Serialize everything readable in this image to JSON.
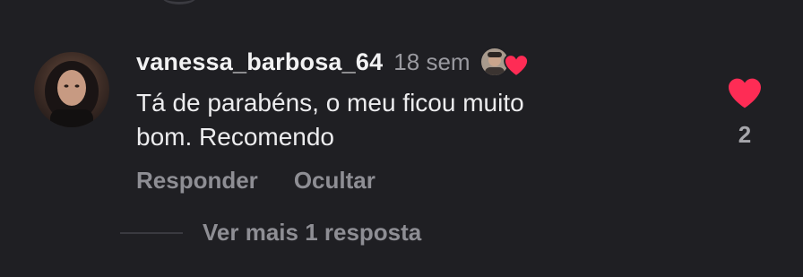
{
  "comment": {
    "username": "vanessa_barbosa_64",
    "time": "18 sem",
    "text": "Tá de parabéns, o meu ficou muito\nbom. Recomendo",
    "actions": {
      "reply_label": "Responder",
      "hide_label": "Ocultar"
    },
    "like_count": "2",
    "heart_color": "#fe2c55",
    "view_replies_label": "Ver mais 1 resposta"
  }
}
